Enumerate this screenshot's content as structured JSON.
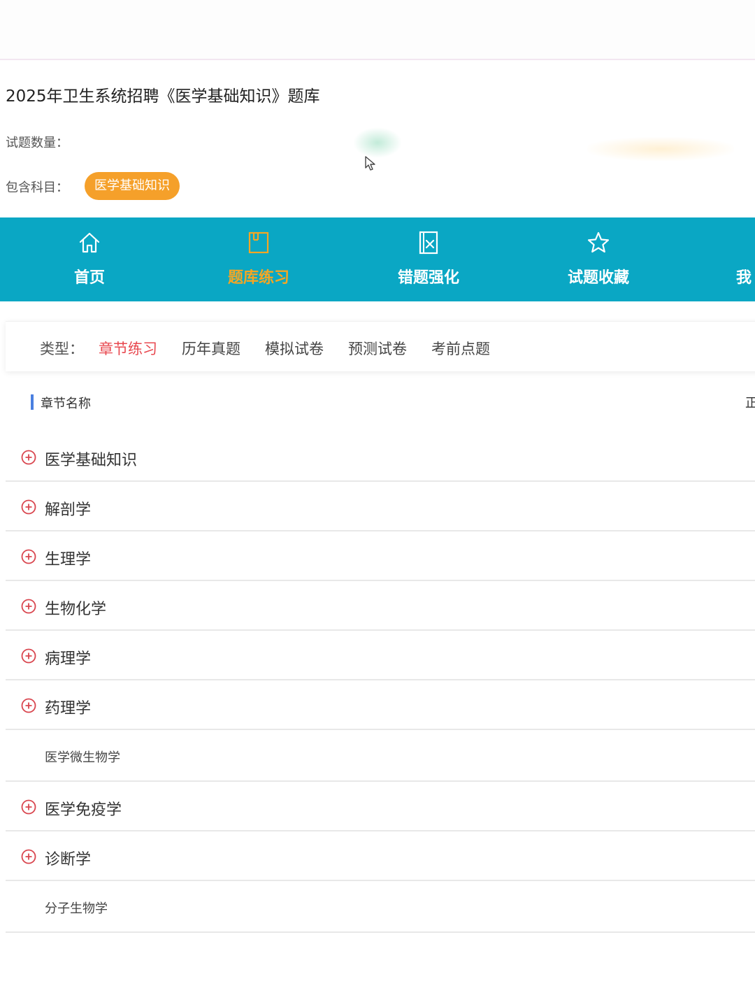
{
  "header": {
    "title": "2025年卫生系统招聘《医学基础知识》题库",
    "count_label": "试题数量：",
    "subject_label": "包含科目：",
    "subject_badge": "医学基础知识"
  },
  "nav": {
    "items": [
      {
        "label": "首页",
        "icon": "home-icon"
      },
      {
        "label": "题库练习",
        "icon": "book-icon",
        "active": true
      },
      {
        "label": "错题强化",
        "icon": "wrong-questions-icon"
      },
      {
        "label": "试题收藏",
        "icon": "star-icon"
      },
      {
        "label": "我",
        "icon": ""
      }
    ]
  },
  "type_filter": {
    "label": "类型：",
    "tabs": [
      "章节练习",
      "历年真题",
      "模拟试卷",
      "预测试卷",
      "考前点题"
    ],
    "active": "章节练习"
  },
  "chapters": {
    "header": "章节名称",
    "header_right": "正",
    "items": [
      {
        "label": "医学基础知识",
        "expandable": true
      },
      {
        "label": "解剖学",
        "expandable": true
      },
      {
        "label": "生理学",
        "expandable": true
      },
      {
        "label": "生物化学",
        "expandable": true
      },
      {
        "label": "病理学",
        "expandable": true
      },
      {
        "label": "药理学",
        "expandable": true
      },
      {
        "label": "医学微生物学",
        "expandable": false
      },
      {
        "label": "医学免疫学",
        "expandable": true
      },
      {
        "label": "诊断学",
        "expandable": true
      },
      {
        "label": "分子生物学",
        "expandable": false
      }
    ]
  },
  "colors": {
    "nav_bg": "#0aa7c4",
    "nav_active": "#f5a623",
    "badge": "#f5a02a",
    "tab_active": "#e8484f",
    "plus_icon": "#d9464f",
    "header_bar": "#4a7fe0"
  }
}
